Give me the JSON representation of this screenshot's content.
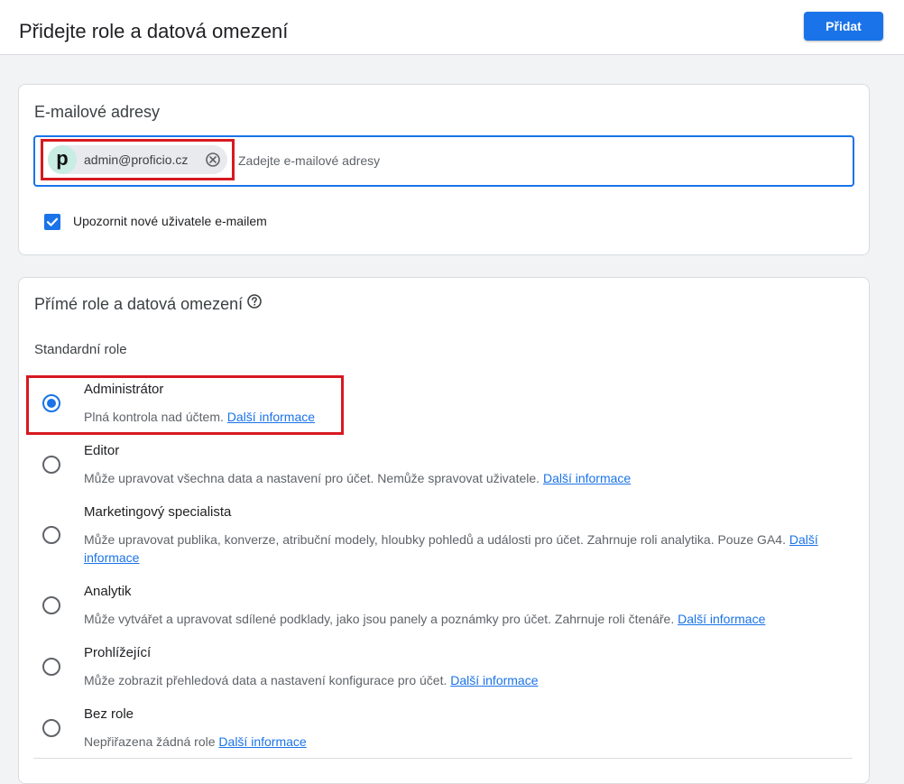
{
  "header": {
    "title": "Přidejte role a datová omezení",
    "add_button_label": "Přidat"
  },
  "email_section": {
    "title": "E-mailové adresy",
    "chip": {
      "avatar_letter": "p",
      "email": "admin@proficio.cz",
      "remove_icon": "close-circle-icon"
    },
    "input_placeholder": "Zadejte e-mailové adresy",
    "notify_checkbox": {
      "label": "Upozornit nové uživatele e-mailem",
      "checked": true
    }
  },
  "roles_section": {
    "title": "Přímé role a datová omezení",
    "help_icon": "help-circle-icon",
    "standard_roles_label": "Standardní role",
    "roles": [
      {
        "name": "Administrátor",
        "description": "Plná kontrola nad účtem.",
        "link": "Další informace",
        "selected": true
      },
      {
        "name": "Editor",
        "description": "Může upravovat všechna data a nastavení pro účet. Nemůže spravovat uživatele.",
        "link": "Další informace",
        "selected": false
      },
      {
        "name": "Marketingový specialista",
        "description": "Může upravovat publika, konverze, atribuční modely, hloubky pohledů a události pro účet. Zahrnuje roli analytika. Pouze GA4.",
        "link": "Další informace",
        "selected": false
      },
      {
        "name": "Analytik",
        "description": "Může vytvářet a upravovat sdílené podklady, jako jsou panely a poznámky pro účet. Zahrnuje roli čtenáře.",
        "link": "Další informace",
        "selected": false
      },
      {
        "name": "Prohlížející",
        "description": "Může zobrazit přehledová data a nastavení konfigurace pro účet.",
        "link": "Další informace",
        "selected": false
      },
      {
        "name": "Bez role",
        "description": "Nepřiřazena žádná role",
        "link": "Další informace",
        "selected": false
      }
    ]
  },
  "colors": {
    "accent": "#1a73e8",
    "highlight_border": "#d71920",
    "background": "#f1f3f4"
  }
}
